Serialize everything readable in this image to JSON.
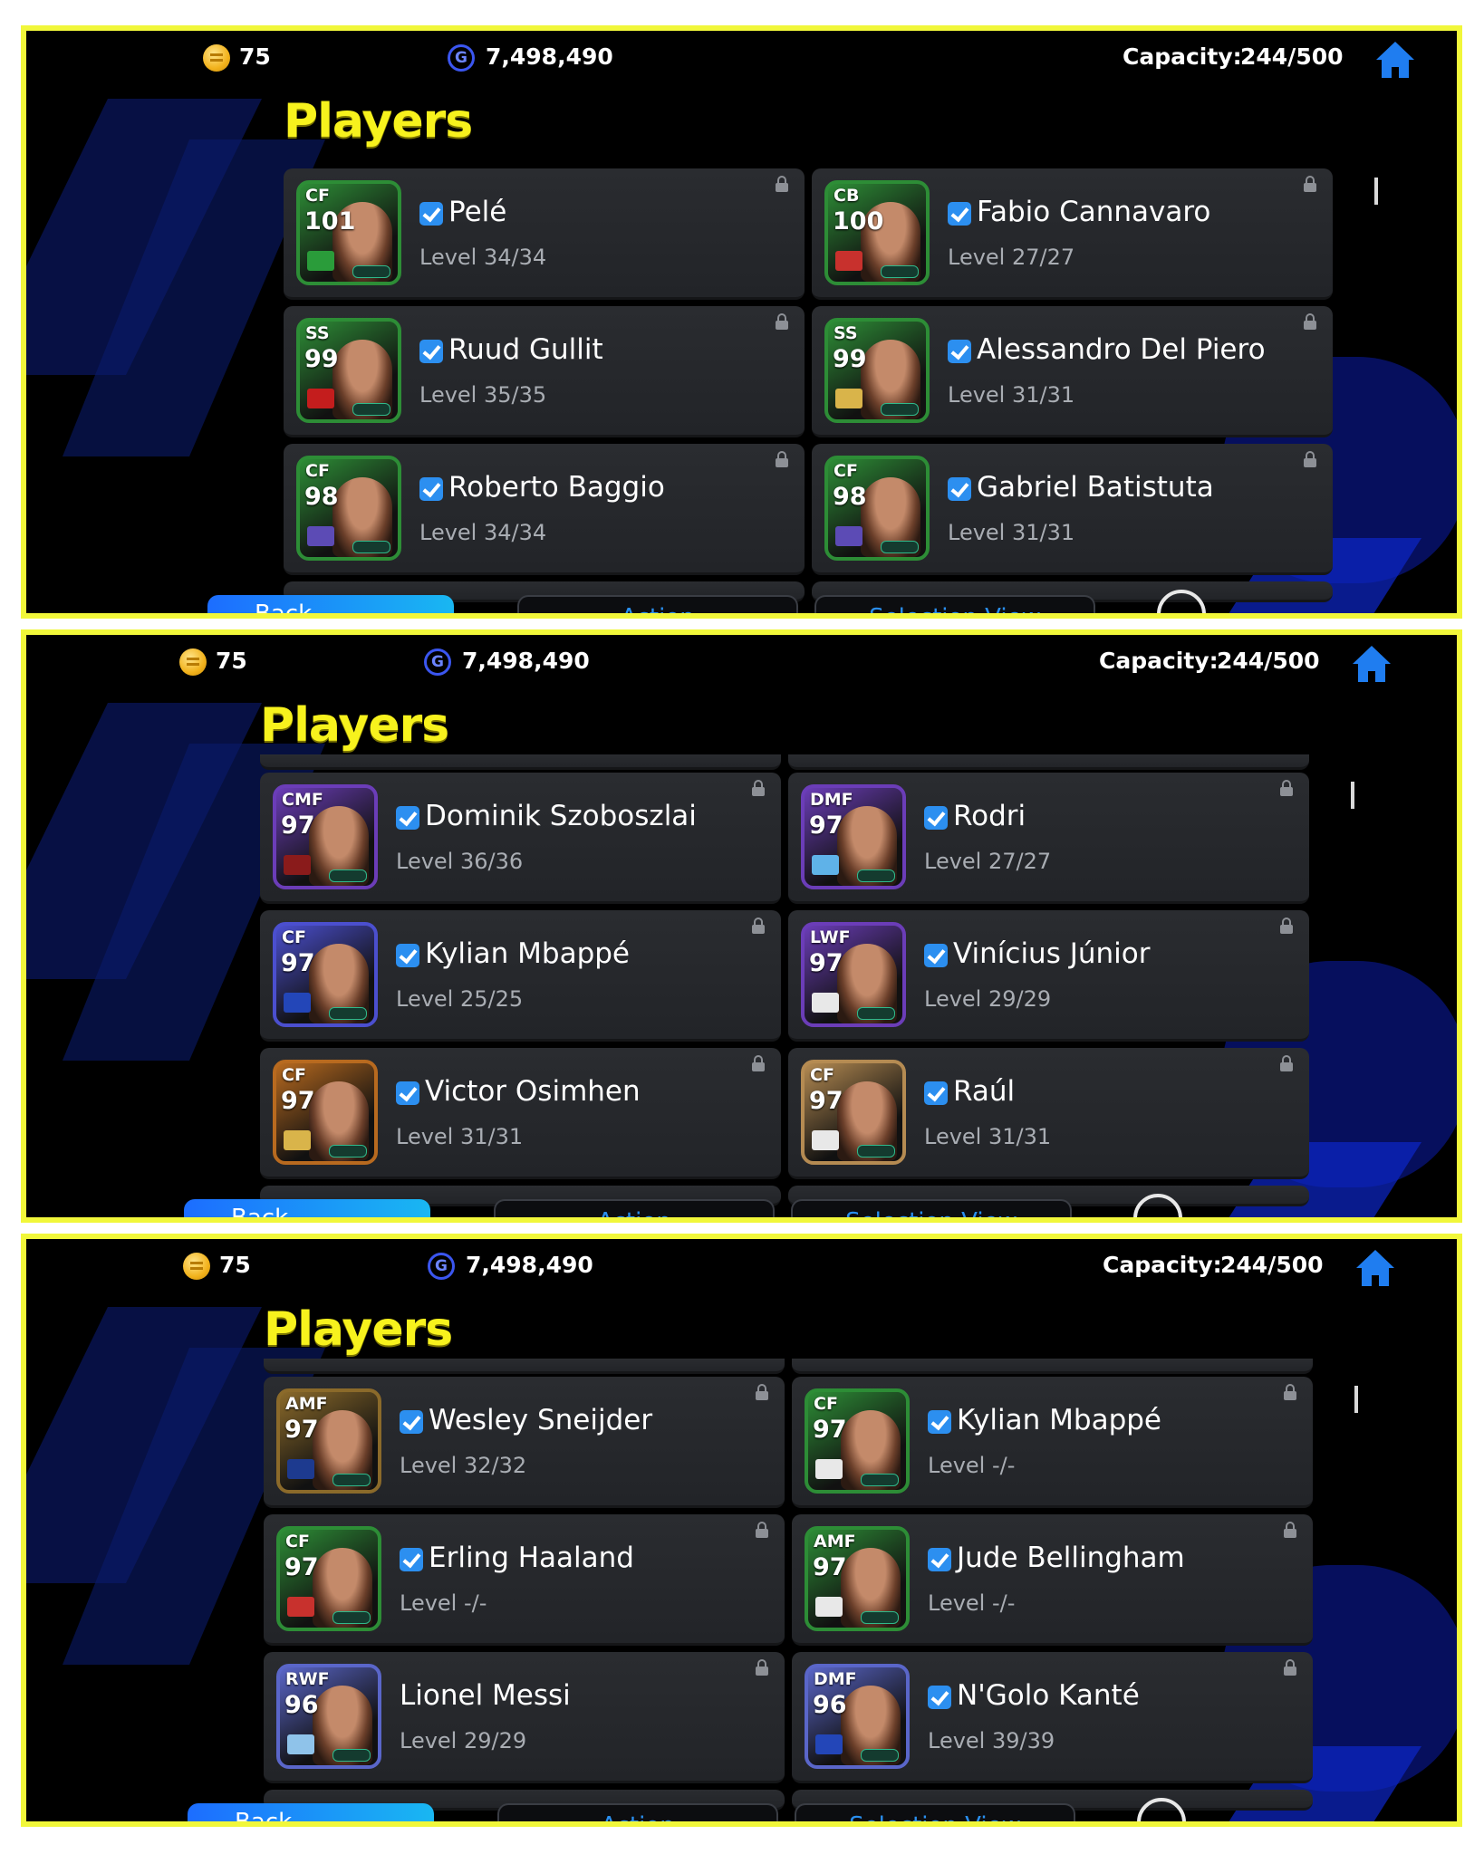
{
  "topbar": {
    "coins": "75",
    "gp": "7,498,490",
    "capacity_label": "Capacity:",
    "capacity_value": "244/500"
  },
  "title": "Players",
  "buttons": {
    "back": "Back",
    "action": "Action",
    "selection_view": "Selection View"
  },
  "panels": [
    {
      "players": [
        {
          "pos": "CF",
          "ovr": "101",
          "name": "Pelé",
          "level": "Level 34/34",
          "checked": true,
          "theme": "#2d8d36",
          "badge": "#2a9c3a"
        },
        {
          "pos": "CB",
          "ovr": "100",
          "name": "Fabio Cannavaro",
          "level": "Level 27/27",
          "checked": true,
          "theme": "#2d8d36",
          "badge": "#c8312d"
        },
        {
          "pos": "SS",
          "ovr": "99",
          "name": "Ruud Gullit",
          "level": "Level 35/35",
          "checked": true,
          "theme": "#2d8d36",
          "badge": "#c41d1d"
        },
        {
          "pos": "SS",
          "ovr": "99",
          "name": "Alessandro Del Piero",
          "level": "Level 31/31",
          "checked": true,
          "theme": "#2d8d36",
          "badge": "#d9b44a"
        },
        {
          "pos": "CF",
          "ovr": "98",
          "name": "Roberto Baggio",
          "level": "Level 34/34",
          "checked": true,
          "theme": "#2d8d36",
          "badge": "#5c4bb5"
        },
        {
          "pos": "CF",
          "ovr": "98",
          "name": "Gabriel Batistuta",
          "level": "Level 31/31",
          "checked": true,
          "theme": "#2d8d36",
          "badge": "#5c4bb5"
        }
      ]
    },
    {
      "players": [
        {
          "pos": "CMF",
          "ovr": "97",
          "name": "Dominik Szoboszlai",
          "level": "Level 36/36",
          "checked": true,
          "theme": "#6b3db8",
          "badge": "#8a1b1b"
        },
        {
          "pos": "DMF",
          "ovr": "97",
          "name": "Rodri",
          "level": "Level 27/27",
          "checked": true,
          "theme": "#6b3db8",
          "badge": "#5fb2e8"
        },
        {
          "pos": "CF",
          "ovr": "97",
          "name": "Kylian Mbappé",
          "level": "Level 25/25",
          "checked": true,
          "theme": "#4b4fcf",
          "badge": "#2346b8"
        },
        {
          "pos": "LWF",
          "ovr": "97",
          "name": "Vinícius Júnior",
          "level": "Level 29/29",
          "checked": true,
          "theme": "#6b3db8",
          "badge": "#e8e8e8"
        },
        {
          "pos": "CF",
          "ovr": "97",
          "name": "Victor Osimhen",
          "level": "Level 31/31",
          "checked": true,
          "theme": "#b86a1f",
          "badge": "#d9b44a"
        },
        {
          "pos": "CF",
          "ovr": "97",
          "name": "Raúl",
          "level": "Level 31/31",
          "checked": true,
          "theme": "#b58b52",
          "badge": "#e8e8e8"
        }
      ]
    },
    {
      "players": [
        {
          "pos": "AMF",
          "ovr": "97",
          "name": "Wesley Sneijder",
          "level": "Level 32/32",
          "checked": true,
          "theme": "#8b6a2a",
          "badge": "#1d3a8f"
        },
        {
          "pos": "CF",
          "ovr": "97",
          "name": "Kylian Mbappé",
          "level": "Level -/-",
          "checked": true,
          "theme": "#2d8d36",
          "badge": "#e8e8e8"
        },
        {
          "pos": "CF",
          "ovr": "97",
          "name": "Erling Haaland",
          "level": "Level -/-",
          "checked": true,
          "theme": "#2d8d36",
          "badge": "#c8312d"
        },
        {
          "pos": "AMF",
          "ovr": "97",
          "name": "Jude Bellingham",
          "level": "Level -/-",
          "checked": true,
          "theme": "#2d8d36",
          "badge": "#e8e8e8"
        },
        {
          "pos": "RWF",
          "ovr": "96",
          "name": "Lionel Messi",
          "level": "Level 29/29",
          "checked": false,
          "theme": "#5a66c9",
          "badge": "#8fc3ea"
        },
        {
          "pos": "DMF",
          "ovr": "96",
          "name": "N'Golo Kanté",
          "level": "Level 39/39",
          "checked": true,
          "theme": "#5a66c9",
          "badge": "#2346b8"
        }
      ]
    }
  ]
}
